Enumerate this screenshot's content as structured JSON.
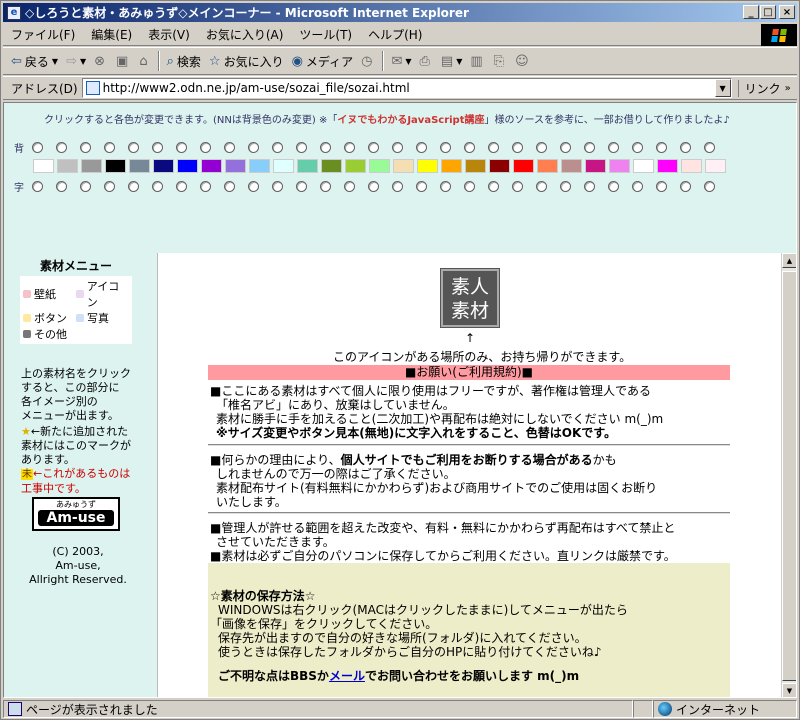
{
  "window": {
    "title": "◇しろうと素材・あみゅうず◇メインコーナー - Microsoft Internet Explorer",
    "min": "_",
    "max": "□",
    "close": "×"
  },
  "menu": [
    "ファイル(F)",
    "編集(E)",
    "表示(V)",
    "お気に入り(A)",
    "ツール(T)",
    "ヘルプ(H)"
  ],
  "toolbar": {
    "back": "戻る",
    "search": "検索",
    "favorites": "お気に入り",
    "media": "メディア"
  },
  "address": {
    "label": "アドレス(D)",
    "url": "http://www2.odn.ne.jp/am-use/sozai_file/sozai.html",
    "links": "リンク"
  },
  "notice": {
    "pre": "クリックすると各色が変更できます。(NNは背景色のみ変更) ※「",
    "highlight": "イヌでもわかるJavaScript講座",
    "post": "」様のソースを参考に、一部お借りして作りましたよ♪"
  },
  "rows": {
    "bg_label": "背",
    "fg_label": "字"
  },
  "swatches": [
    "#ffffff",
    "#c0c0c0",
    "#999999",
    "#000000",
    "#778899",
    "#0a0a80",
    "#0000ff",
    "#9400d3",
    "#9370db",
    "#87cefa",
    "#e0ffff",
    "#66cdaa",
    "#6b8e23",
    "#9acd32",
    "#98fb98",
    "#f5deb3",
    "#ffff00",
    "#ffa500",
    "#b8860b",
    "#8b0000",
    "#ff0000",
    "#ff7f50",
    "#bc8f8f",
    "#c71585",
    "#ee82ee",
    "#ffffff",
    "#ff00ff",
    "#ffe4e1",
    "#fff0f5"
  ],
  "side": {
    "menu_title": "素材メニュー",
    "items": [
      {
        "label": "壁紙",
        "color": "#f4c2c8"
      },
      {
        "label": "アイコン",
        "color": "#e8d8f0"
      },
      {
        "label": "ボタン",
        "color": "#ffe9a0"
      },
      {
        "label": "写真",
        "color": "#d0e0f8"
      },
      {
        "label": "その他",
        "color": "#777777"
      }
    ],
    "help1": [
      "上の素材名をクリック",
      "すると、この部分に",
      "各イメージ別の",
      "メニューが出ます。"
    ],
    "new_mark": "★",
    "help2": [
      "←新たに追加された",
      "素材にはこのマークが",
      "あります。"
    ],
    "wip_mark": "未",
    "wip_text": [
      "←これがあるものは",
      "工事中です。"
    ],
    "logo_small": "あみゅうず",
    "logo_big": "Am-use",
    "copyright": [
      "(C) 2003,",
      "Am-use,",
      "Allright Reserved."
    ]
  },
  "main": {
    "icon_text": [
      "素人",
      "素材"
    ],
    "arrow": "↑",
    "icon_note": "このアイコンがある場所のみ、お持ち帰りができます。",
    "request": "■お願い(ご利用規約)■",
    "s1": [
      "■ここにある素材はすべて個人に限り使用はフリーですが、著作権は管理人である",
      "「椎名アビ」にあり、放棄はしていません。",
      "素材に勝手に手を加えること(二次加工)や再配布は絶対にしないでください m(_)m"
    ],
    "s1_bold": "※サイズ変更やボタン見本(無地)に文字入れをすること、色替はOKです。",
    "s2_pre": "■何らかの理由により、",
    "s2_bold": "個人サイトでもご利用をお断りする場合がある",
    "s2_post": "かも",
    "s2_lines": [
      "しれませんので万一の際はご了承ください。",
      "素材配布サイト(有料無料にかかわらず)および商用サイトでのご使用は固くお断り",
      "いたします。"
    ],
    "s3": [
      "■管理人が許せる範囲を超えた改変や、有料・無料にかかわらず再配布はすべて禁止と",
      "させていただきます。",
      "■素材は必ずご自分のパソコンに保存してからご利用ください。直リンクは厳禁です。"
    ],
    "save_title": "☆素材の保存方法☆",
    "save_lines": [
      "WINDOWSは右クリック(MACはクリックしたままに)してメニューが出たら",
      "「画像を保存」をクリックしてください。",
      "保存先が出ますので自分の好きな場所(フォルダ)に入れてください。",
      "使うときは保存したフォルダからご自分のHPに貼り付けてくださいね♪"
    ],
    "contact_pre": "ご不明な点はBBSか",
    "contact_link": "メール",
    "contact_post": "でお問い合わせをお願いします m(_)m"
  },
  "status": {
    "text": "ページが表示されました",
    "zone": "インターネット"
  }
}
